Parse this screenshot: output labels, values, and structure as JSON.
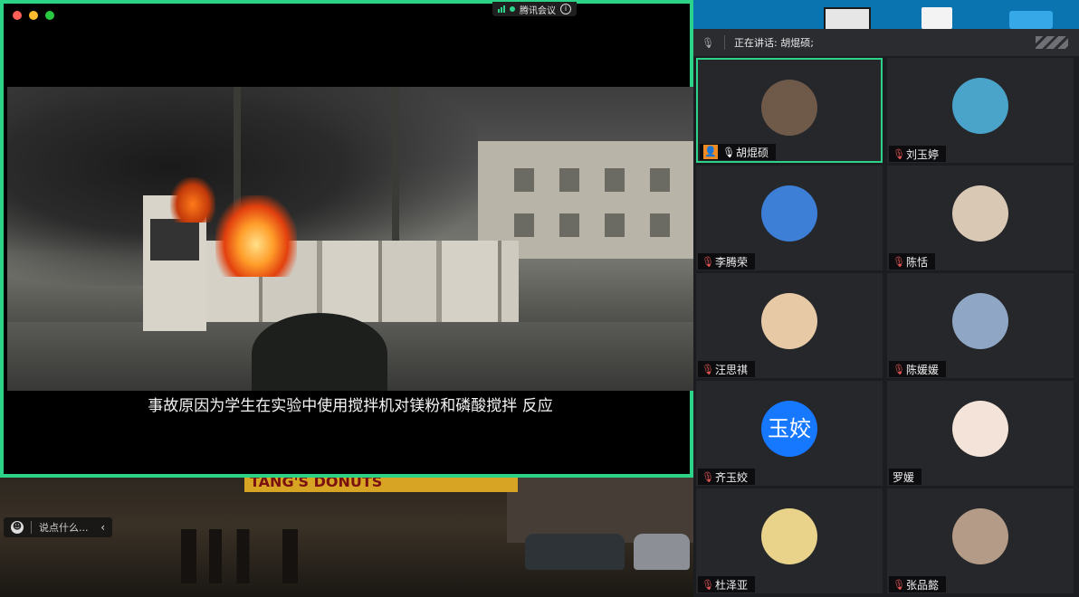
{
  "app": {
    "name": "腾讯会议",
    "info_icon": "info-icon"
  },
  "shared_screen": {
    "subtitle": "事故原因为学生在实验中使用搅拌机对镁粉和磷酸搅拌 反应"
  },
  "background": {
    "street_sign": "TANG'S DONUTS",
    "chat_placeholder": "说点什么..."
  },
  "speaking": {
    "label": "正在讲话: 胡焜硕;"
  },
  "participants": [
    {
      "name": "胡焜硕",
      "host": true,
      "mic": "on",
      "active": true,
      "avatar_color": "#6f5a4a"
    },
    {
      "name": "刘玉婷",
      "mic": "muted",
      "avatar_color": "#4aa3c8"
    },
    {
      "name": "李腾荣",
      "mic": "muted",
      "avatar_color": "#3d7fd6"
    },
    {
      "name": "陈恬",
      "mic": "muted",
      "avatar_color": "#d9c9b4"
    },
    {
      "name": "汪思祺",
      "mic": "muted",
      "avatar_color": "#e7c9a6"
    },
    {
      "name": "陈媛媛",
      "mic": "muted",
      "avatar_color": "#8fa7c4"
    },
    {
      "name": "齐玉姣",
      "mic": "muted",
      "avatar_text": "玉姣",
      "avatar_color": "#1677ff"
    },
    {
      "name": "罗媛",
      "mic": "none",
      "avatar_color": "#f3e3d8"
    },
    {
      "name": "杜泽亚",
      "mic": "muted",
      "avatar_color": "#e9d28a"
    },
    {
      "name": "张品懿",
      "mic": "muted",
      "avatar_color": "#b49b87"
    }
  ]
}
